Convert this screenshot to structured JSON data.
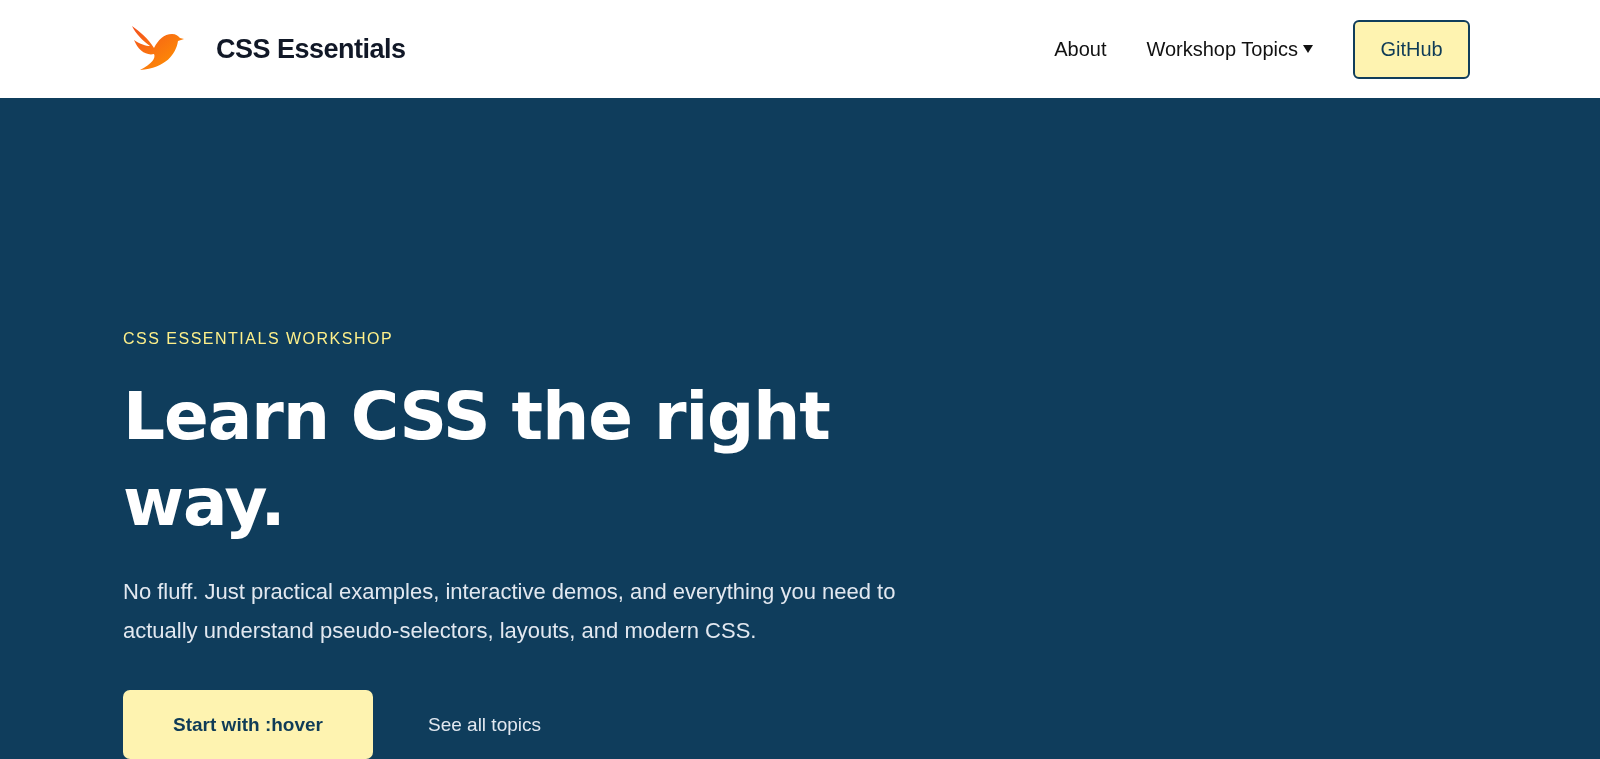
{
  "header": {
    "brand": "CSS Essentials",
    "nav": [
      {
        "label": "About",
        "kind": "link"
      },
      {
        "label": "Workshop Topics",
        "kind": "dropdown"
      },
      {
        "label": "GitHub",
        "kind": "button"
      }
    ]
  },
  "hero": {
    "eyebrow": "CSS ESSENTIALS WORKSHOP",
    "title": "Learn CSS the right way.",
    "description": "No fluff. Just practical examples, interactive demos, and everything you need to actually understand pseudo-selectors, layouts, and modern CSS.",
    "actions": [
      {
        "label": "Start with :hover",
        "kind": "primary"
      },
      {
        "label": "See all topics",
        "kind": "link"
      }
    ]
  }
}
